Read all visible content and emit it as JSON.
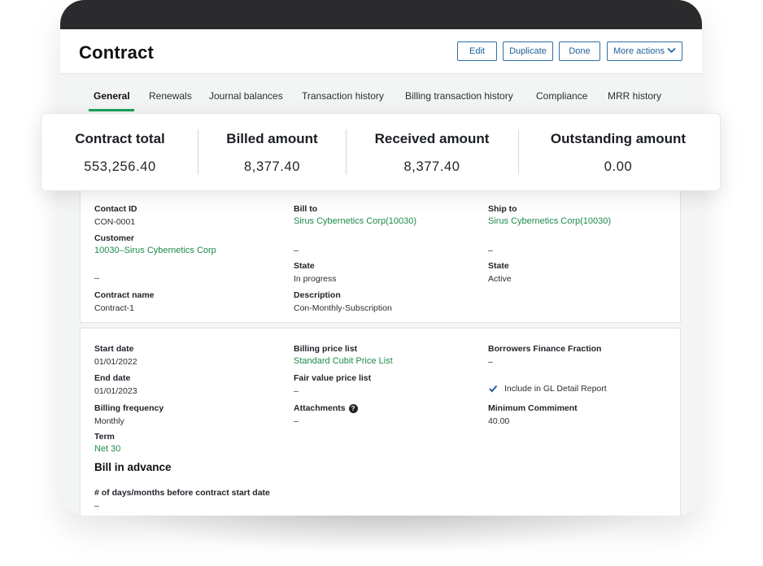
{
  "page": {
    "title": "Contract"
  },
  "actions": {
    "edit": "Edit",
    "duplicate": "Duplicate",
    "done": "Done",
    "more": "More actions"
  },
  "tabs": [
    {
      "label": "General",
      "active": true
    },
    {
      "label": "Renewals"
    },
    {
      "label": "Journal balances"
    },
    {
      "label": "Transaction history"
    },
    {
      "label": "Billing transaction history"
    },
    {
      "label": "Compliance"
    },
    {
      "label": "MRR history"
    }
  ],
  "summary": [
    {
      "label": "Contract total",
      "value": "553,256.40"
    },
    {
      "label": "Billed amount",
      "value": "8,377.40"
    },
    {
      "label": "Received amount",
      "value": "8,377.40"
    },
    {
      "label": "Outstanding amount",
      "value": "0.00"
    }
  ],
  "details": {
    "contact_id_label": "Contact ID",
    "contact_id": "CON-0001",
    "customer_label": "Customer",
    "customer": "10030–Sirus Cybernetics Corp",
    "customer_extra": "–",
    "contract_name_label": "Contract name",
    "contract_name": "Contract-1",
    "bill_to_label": "Bill to",
    "bill_to": "Sirus Cybernetics Corp(10030)",
    "bill_to_extra": "–",
    "bill_state_label": "State",
    "bill_state": "In progress",
    "description_label": "Description",
    "description": "Con-Monthly-Subscription",
    "ship_to_label": "Ship to",
    "ship_to": "Sirus Cybernetics Corp(10030)",
    "ship_to_extra": "–",
    "ship_state_label": "State",
    "ship_state": "Active"
  },
  "terms": {
    "start_date_label": "Start date",
    "start_date": "01/01/2022",
    "end_date_label": "End date",
    "end_date": "01/01/2023",
    "billing_frequency_label": "Billing frequency",
    "billing_frequency": "Monthly",
    "term_label": "Term",
    "term": "Net 30",
    "billing_price_list_label": "Billing price list",
    "billing_price_list": "Standard Cubit Price List",
    "fair_value_label": "Fair value price list",
    "fair_value": "–",
    "attachments_label": "Attachments",
    "attachments": "–",
    "borrowers_label": "Borrowers Finance Fraction",
    "borrowers": "–",
    "gl_report_label": "Include in GL Detail Report",
    "gl_report_checked": true,
    "min_commit_label": "Minimum Commiment",
    "min_commit": "40.00",
    "bill_in_advance_title": "Bill in advance",
    "days_before_label": "# of days/months before contract start date",
    "days_before": "–"
  },
  "colors": {
    "accent_green": "#18a05a",
    "link_green": "#1d8a4c",
    "button_blue": "#2e6fa8"
  }
}
